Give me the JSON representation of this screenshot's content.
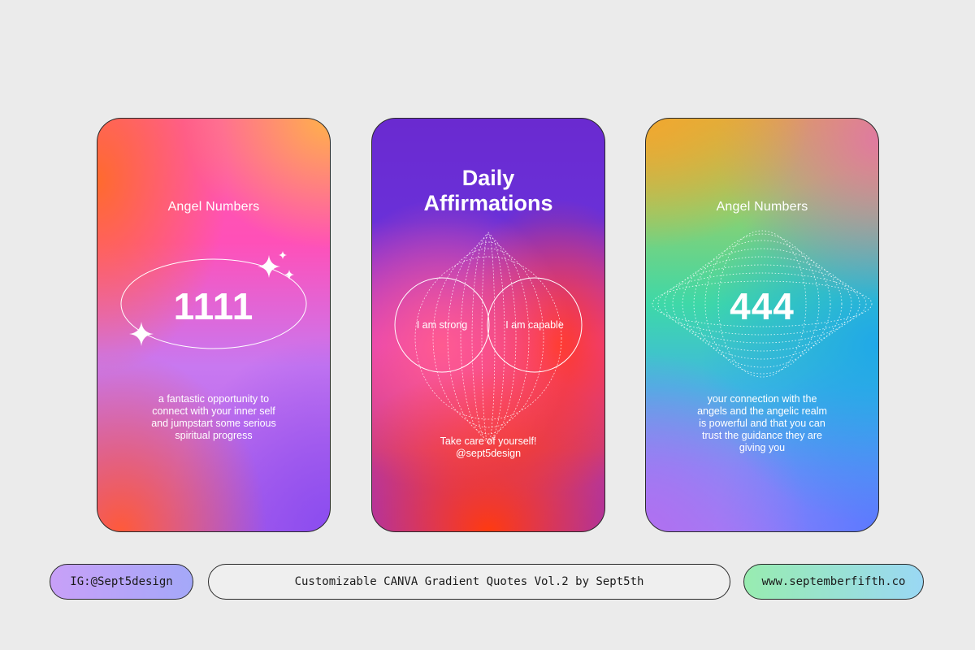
{
  "cards": [
    {
      "title": "Angel Numbers",
      "number": "1111",
      "description_lines": [
        "a fantastic opportunity to",
        "connect with your inner self",
        "and jumpstart some serious",
        "spiritual progress"
      ]
    },
    {
      "title_lines": [
        "Daily",
        "Affirmations"
      ],
      "left_circle_text": "I am strong",
      "right_circle_text": "I am capable",
      "footer_lines": [
        "Take care of yourself!",
        "@sept5design"
      ]
    },
    {
      "title": "Angel Numbers",
      "number": "444",
      "description_lines": [
        "your connection with the",
        "angels and the angelic realm",
        "is powerful and that you can",
        "trust the guidance they are",
        "giving you"
      ]
    }
  ],
  "footer": {
    "instagram": "IG:@Sept5design",
    "caption": "Customizable CANVA Gradient Quotes Vol.2 by Sept5th",
    "website": "www.septemberfifth.co"
  }
}
